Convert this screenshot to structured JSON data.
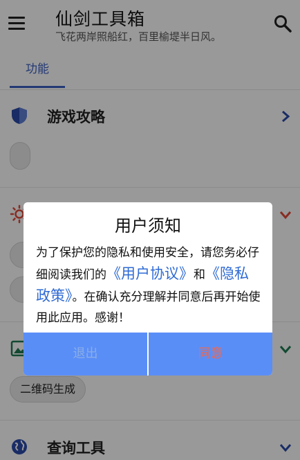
{
  "header": {
    "title": "仙剑工具箱",
    "subtitle": "飞花两岸照船红，百里榆堤半日风。",
    "menu_icon": "menu-icon",
    "search_icon": "search-icon"
  },
  "tabs": [
    {
      "label": "功能",
      "active": true
    }
  ],
  "sections": [
    {
      "title": "游戏攻略",
      "icon": "shield-icon",
      "arrow": "chevron-right-icon",
      "chips": [
        ""
      ]
    },
    {
      "title": "",
      "icon": "sun-icon",
      "arrow": "chevron-down-icon",
      "chips": [
        "",
        ""
      ]
    },
    {
      "title": "",
      "icon": "image-icon",
      "arrow": "chevron-down-icon",
      "chips": [
        "二维码生成"
      ]
    },
    {
      "title": "查询工具",
      "icon": "globe-icon",
      "arrow": "chevron-down-icon",
      "chips": []
    }
  ],
  "dialog": {
    "title": "用户须知",
    "body_part1": "为了保护您的隐私和使用安全，请您务必仔细阅读我们的",
    "link_user_agreement": "《用户协议》",
    "body_and": "和",
    "link_privacy_policy": "《隐私政策》",
    "body_part2": "。在确认充分理解并同意后再开始使用此应用。感谢！",
    "exit_label": "退出",
    "agree_label": "同意"
  },
  "colors": {
    "accent": "#3b5fc4",
    "dialog_button_bar": "#5a8ef7",
    "agree_text": "#e76b59",
    "link": "#2f6bd4"
  }
}
